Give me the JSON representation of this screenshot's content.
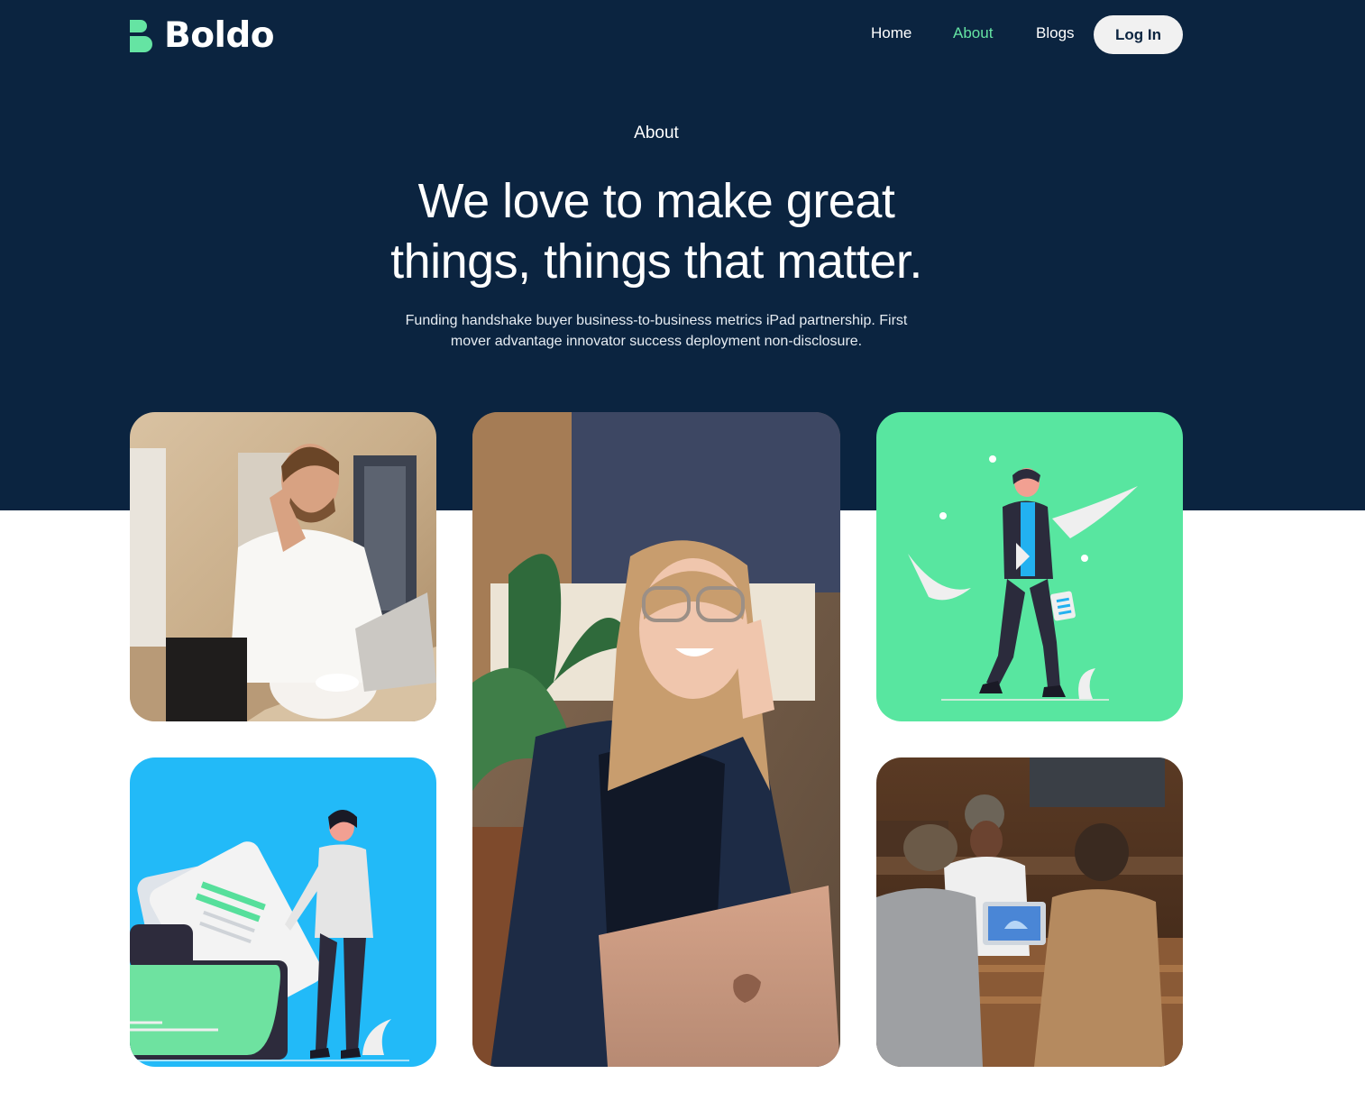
{
  "brand": {
    "name": "Boldo",
    "accent_color": "#65e4a3",
    "dark_color": "#0b2440"
  },
  "nav": {
    "items": [
      {
        "label": "Home",
        "active": false
      },
      {
        "label": "About",
        "active": true
      },
      {
        "label": "Blogs",
        "active": false
      }
    ],
    "login_label": "Log In"
  },
  "hero": {
    "eyebrow": "About",
    "headline_line1": "We love to make great",
    "headline_line2": "things, things that matter.",
    "description_line1": "Funding handshake buyer business-to-business metrics iPad partnership. First",
    "description_line2": "mover advantage innovator success deployment non-disclosure."
  },
  "gallery": {
    "cards": [
      {
        "kind": "photo",
        "subject": "man-on-phone-with-laptop"
      },
      {
        "kind": "photo",
        "subject": "woman-on-phone-with-laptop"
      },
      {
        "kind": "illustration",
        "subject": "walking-businessman-illustration",
        "background": "#58e6a0"
      },
      {
        "kind": "illustration",
        "subject": "man-with-documents-illustration",
        "background": "#22baf8"
      },
      {
        "kind": "photo",
        "subject": "team-meeting-around-laptop"
      }
    ]
  }
}
